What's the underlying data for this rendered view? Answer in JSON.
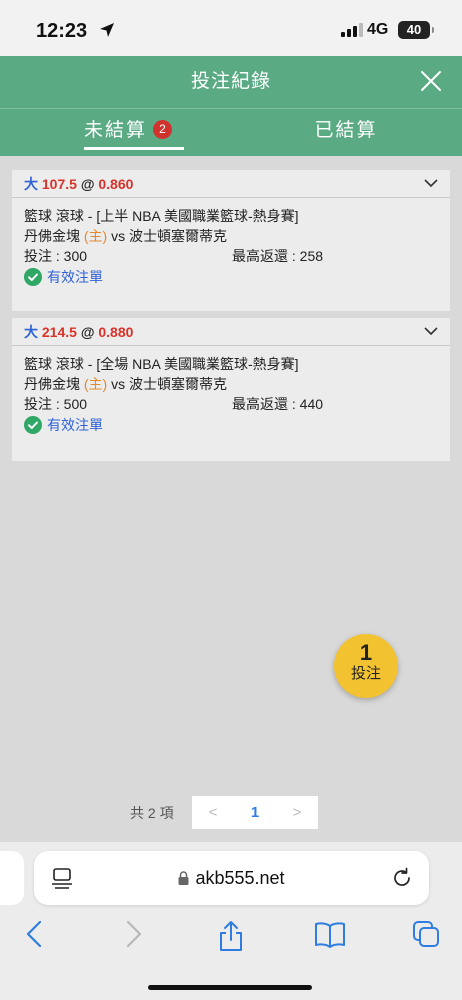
{
  "status_bar": {
    "time": "12:23",
    "network": "4G",
    "battery": "40"
  },
  "header": {
    "title": "投注紀錄"
  },
  "tabs": [
    {
      "label": "未結算",
      "badge": "2",
      "active": true
    },
    {
      "label": "已結算",
      "active": false
    }
  ],
  "bets": [
    {
      "selection": "大",
      "line": "107.5",
      "at": "@",
      "odds": "0.860",
      "league": "籃球 滾球 - [上半 NBA 美國職業籃球-熱身賽]",
      "home_team": "丹佛金塊",
      "home_tag": "(主)",
      "vs": "vs",
      "away_team": "波士頓塞爾蒂克",
      "stake": "投注 : 300",
      "max_return": "最高返還 : 258",
      "status": "有效注單"
    },
    {
      "selection": "大",
      "line": "214.5",
      "at": "@",
      "odds": "0.880",
      "league": "籃球 滾球 - [全場 NBA 美國職業籃球-熱身賽]",
      "home_team": "丹佛金塊",
      "home_tag": "(主)",
      "vs": "vs",
      "away_team": "波士頓塞爾蒂克",
      "stake": "投注 : 500",
      "max_return": "最高返還 : 440",
      "status": "有效注單"
    }
  ],
  "bet_slip": {
    "count": "1",
    "label": "投注"
  },
  "pagination": {
    "total": "共 2 項",
    "prev": "<",
    "current": "1",
    "next": ">"
  },
  "browser": {
    "url": "akb555.net"
  },
  "colors": {
    "header_green": "#5aaa84",
    "accent_blue": "#2f62d6",
    "odds_red": "#d8322a",
    "badge_red": "#d2322d",
    "home_orange": "#e38a2e",
    "fab_yellow": "#f2c230",
    "page_bg": "#d9d9d9",
    "card_bg": "#ececec"
  },
  "icons": [
    "location-arrow-icon",
    "signal-icon",
    "close-icon",
    "chevron-down-icon",
    "check-circle-icon",
    "reader-icon",
    "lock-icon",
    "reload-icon",
    "back-icon",
    "forward-icon",
    "share-icon",
    "bookmarks-icon",
    "tabs-icon"
  ]
}
